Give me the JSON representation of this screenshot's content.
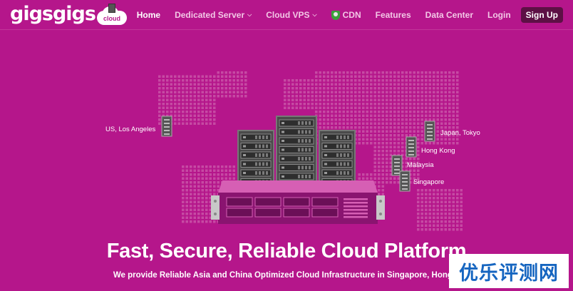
{
  "brand": {
    "logo_text": "gigsgigs",
    "badge_text": "cloud"
  },
  "nav": {
    "items": [
      {
        "label": "Home",
        "active": true
      },
      {
        "label": "Dedicated Server",
        "has_dropdown": true
      },
      {
        "label": "Cloud VPS",
        "has_dropdown": true
      },
      {
        "label": "CDN",
        "icon": "shield-icon"
      },
      {
        "label": "Features"
      },
      {
        "label": "Data Center"
      },
      {
        "label": "Login"
      }
    ],
    "signup_label": "Sign Up"
  },
  "locations": [
    {
      "label": "US, Los Angeles"
    },
    {
      "label": "Japan, Tokyo"
    },
    {
      "label": "Hong Kong"
    },
    {
      "label": "Malaysia"
    },
    {
      "label": "Singapore"
    }
  ],
  "hero": {
    "headline": "Fast, Secure, Reliable Cloud Platform",
    "subline": "We provide Reliable Asia and China Optimized Cloud Infrastructure in Singapore, Hong Kong, Japan"
  },
  "watermark": {
    "text": "优乐评测网"
  },
  "colors": {
    "background": "#b5168b",
    "server_panel": "#8a1470",
    "signup_bg": "#5d1045",
    "watermark_text": "#1565c0"
  }
}
